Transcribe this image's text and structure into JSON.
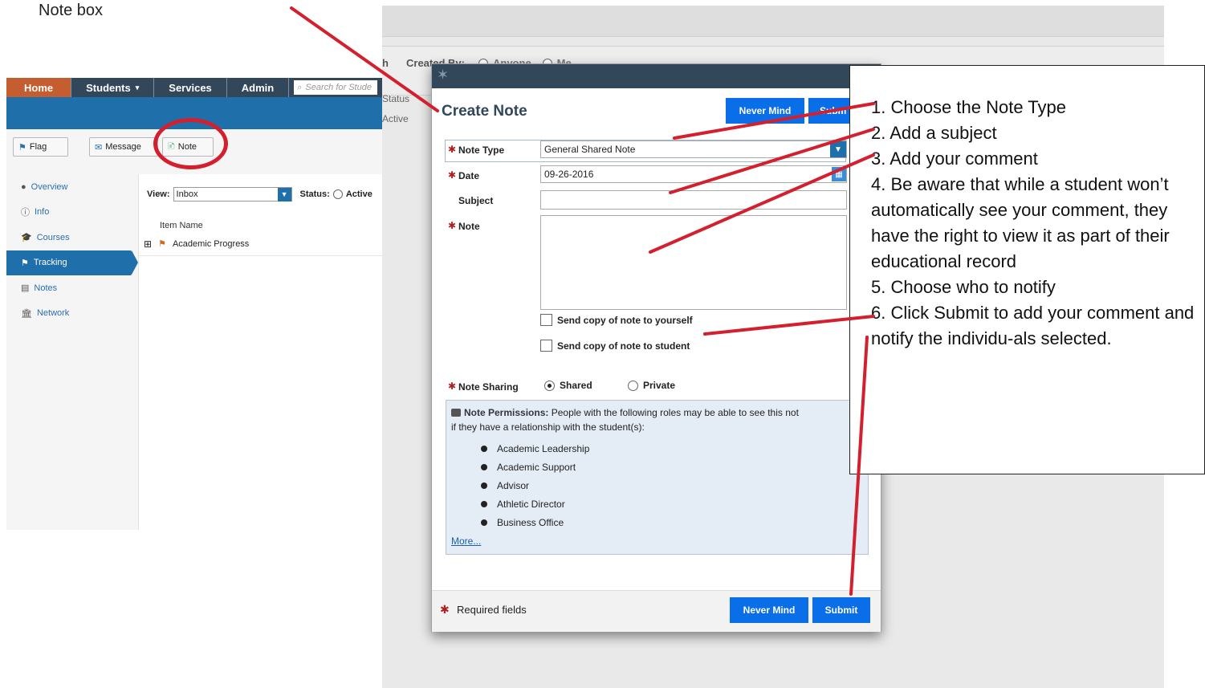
{
  "caption": "Note box",
  "app": {
    "nav": [
      "Home",
      "Students",
      "Services",
      "Admin"
    ],
    "search_placeholder": "Search for Stude",
    "toolbar": {
      "flag": "Flag",
      "message": "Message",
      "note": "Note"
    },
    "sidebar": [
      "Overview",
      "Info",
      "Courses",
      "Tracking",
      "Notes",
      "Network"
    ],
    "view_label": "View:",
    "view_value": "Inbox",
    "status_label": "Status:",
    "status_option": "Active",
    "column_header": "Item Name",
    "row": "Academic Progress"
  },
  "background": {
    "created_by_label": "Created By:",
    "created_by_options": [
      "Anyone",
      "Me"
    ],
    "h_fragment": "h",
    "status_header": "Status",
    "status_value": "Active"
  },
  "modal": {
    "title": "Create Note",
    "never_mind": "Never Mind",
    "submit_top": "Subm",
    "note_type_label": "Note Type",
    "note_type_value": "General Shared Note",
    "date_label": "Date",
    "date_value": "09-26-2016",
    "subject_label": "Subject",
    "note_label": "Note",
    "copy_self": "Send copy of note to yourself",
    "copy_student": "Send copy of note to student",
    "sharing_label": "Note Sharing",
    "sharing_shared": "Shared",
    "sharing_private": "Private",
    "permissions_title": "Note Permissions:",
    "permissions_text": "People with the following roles may be able to see this not",
    "permissions_text2": "if they have a relationship with the student(s):",
    "roles": [
      "Academic Leadership",
      "Academic Support",
      "Advisor",
      "Athletic Director",
      "Business Office"
    ],
    "more": "More...",
    "required": "Required fields",
    "footer_never_mind": "Never Mind",
    "footer_submit": "Submit"
  },
  "instructions": [
    "1. Choose the Note Type",
    "2. Add a subject",
    "3. Add your comment",
    "4. Be aware that while a student won’t automatically see your comment, they have the right to view it as part of their educational record",
    "5. Choose who to notify",
    "6. Click Submit to add your comment and notify the individu-als selected."
  ],
  "colors": {
    "annotation_red": "#d4202e",
    "nav_dark": "#33475b",
    "primary_blue": "#0a6ee8",
    "home_orange": "#c45e30"
  }
}
